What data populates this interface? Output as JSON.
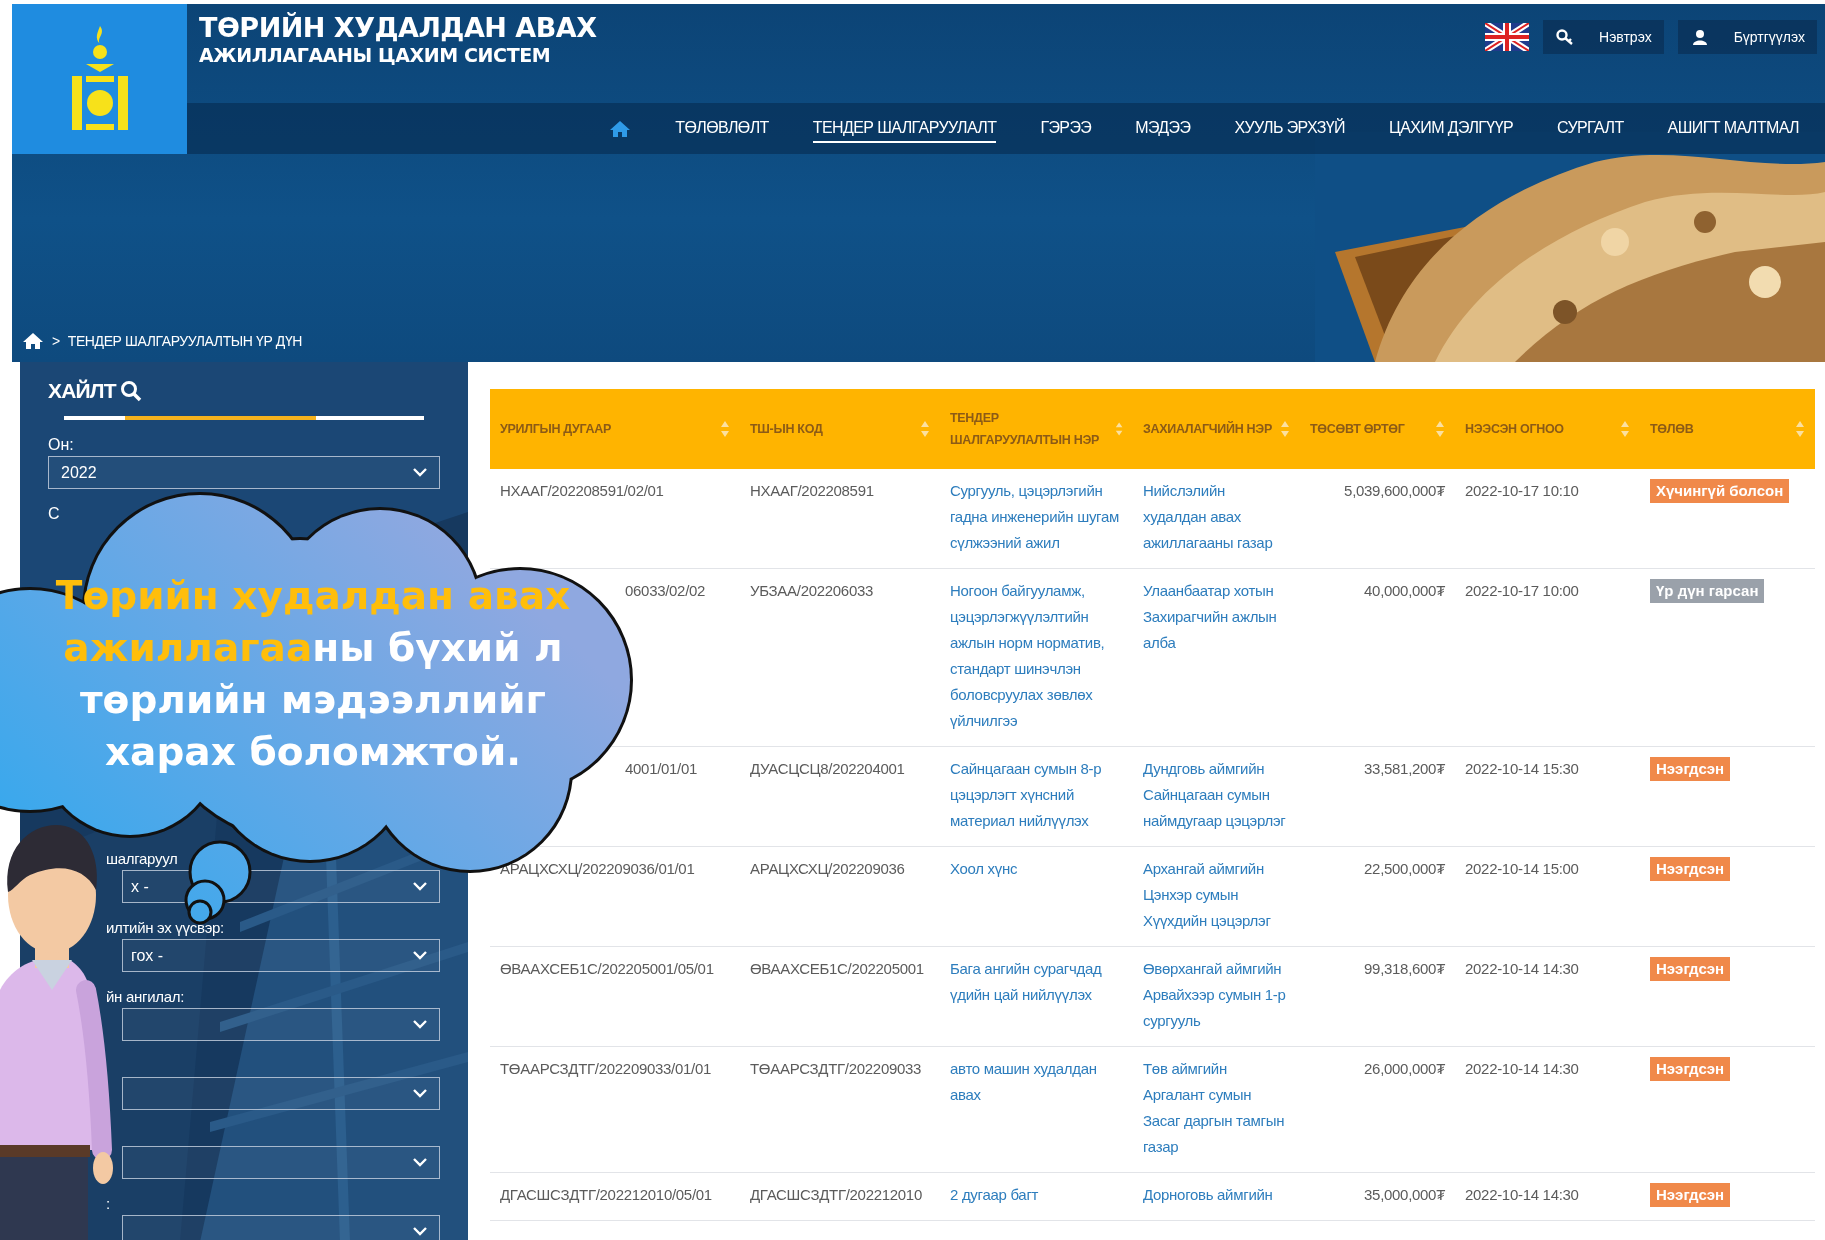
{
  "header": {
    "title_line_1": "ТӨРИЙН ХУДАЛДАН АВАХ",
    "title_line_2": "АЖИЛЛАГААНЫ ЦАХИМ СИСТЕМ",
    "login": "Нэвтрэх",
    "register": "Бүртгүүлэх"
  },
  "nav": [
    {
      "label": "ТӨЛӨВЛӨЛТ",
      "selected": false
    },
    {
      "label": "ТЕНДЕР ШАЛГАРУУЛАЛТ",
      "selected": true
    },
    {
      "label": "ГЭРЭЭ",
      "selected": false
    },
    {
      "label": "МЭДЭЭ",
      "selected": false
    },
    {
      "label": "ХУУЛЬ ЭРХЗҮЙ",
      "selected": false
    },
    {
      "label": "ЦАХИМ ДЭЛГҮҮР",
      "selected": false
    },
    {
      "label": "СУРГАЛТ",
      "selected": false
    },
    {
      "label": "АШИГТ МАЛТМАЛ",
      "selected": false
    }
  ],
  "breadcrumb": {
    "separator": ">",
    "current": "ТЕНДЕР ШАЛГАРУУЛАЛТЫН ҮР ДҮН"
  },
  "sidebar": {
    "title": "ХАЙЛТ",
    "fields": [
      {
        "kind": "select",
        "label": "Он:",
        "value": "2022"
      },
      {
        "kind": "covered",
        "label": "С"
      },
      {
        "kind": "covered"
      },
      {
        "kind": "covered"
      },
      {
        "kind": "covered"
      },
      {
        "kind": "covered"
      },
      {
        "kind": "select-cut",
        "label": "шалгаруул",
        "value": "х -"
      },
      {
        "kind": "select-cut",
        "label": "илтийн эх үүсвэр:",
        "value": "гох -"
      },
      {
        "kind": "select-cut",
        "label": "йн ангилал:"
      },
      {
        "kind": "select-cut"
      },
      {
        "kind": "select-cut"
      },
      {
        "kind": "select-cut",
        "label": ":"
      }
    ]
  },
  "table": {
    "columns": [
      "УРИЛГЫН ДУГААР",
      "ТШ-ЫН КОД",
      "ТЕНДЕР ШАЛГАРУУЛАЛТЫН НЭР",
      "ЗАХИАЛАГЧИЙН НЭР",
      "ТӨСӨВТ ӨРТӨГ",
      "НЭЭСЭН ОГНОО",
      "ТӨЛӨВ"
    ],
    "rows": [
      {
        "covered": false,
        "invitation": "НХААГ/202208591/02/01",
        "code": "НХААГ/202208591",
        "tender": "Сургууль, цэцэрлэгийн гадна инженерийн шугам сүлжээний ажил",
        "customer": "Нийслэлийн худалдан авах ажиллагааны газар",
        "budget": "5,039,600,000₮",
        "opened": "2022-10-17 10:10",
        "status": "Хүчингүй болсон",
        "color": "#f0894a"
      },
      {
        "covered": true,
        "invitation": "06033/02/02",
        "code": "УБЗАА/202206033",
        "tender": "Ногоон байгууламж, цэцэрлэгжүүлэлтийн ажлын норм норматив, стандарт шинэчлэн боловсруулах зөвлөх үйлчилгээ",
        "customer": "Улаанбаатар хотын Захирагчийн ажлын алба",
        "budget": "40,000,000₮",
        "opened": "2022-10-17 10:00",
        "status": "Үр дүн гарсан",
        "color": "#9aa1aa"
      },
      {
        "covered": true,
        "invitation": "4001/01/01",
        "code": "ДУАСЦСЦ8/202204001",
        "tender": "Сайнцагаан сумын 8-р цэцэрлэгт хүнсний материал нийлүүлэх",
        "customer": "Дундговь аймгийн Сайнцагаан сумын наймдугаар цэцэрлэг",
        "budget": "33,581,200₮",
        "opened": "2022-10-14 15:30",
        "status": "Нээгдсэн",
        "color": "#f0894a"
      },
      {
        "covered": false,
        "invitation": "АРАЦХСХЦ/202209036/01/01",
        "code": "АРАЦХСХЦ/202209036",
        "tender": "Хоол хүнс",
        "customer": "Архангай аймгийн Цэнхэр сумын Хүүхдийн цэцэрлэг",
        "budget": "22,500,000₮",
        "opened": "2022-10-14 15:00",
        "status": "Нээгдсэн",
        "color": "#f0894a"
      },
      {
        "covered": false,
        "invitation": "ӨВААХСЕБ1С/202205001/05/01",
        "code": "ӨВААХСЕБ1С/202205001",
        "tender": "Бага ангийн сурагчдад үдийн цай нийлүүлэх",
        "customer": "Өвөрхангай аймгийн Арвайхээр сумын 1-р сургууль",
        "budget": "99,318,600₮",
        "opened": "2022-10-14 14:30",
        "status": "Нээгдсэн",
        "color": "#f0894a"
      },
      {
        "covered": false,
        "invitation": "ТӨААРСЗДТГ/202209033/01/01",
        "code": "ТӨААРСЗДТГ/202209033",
        "tender": "авто машин худалдан авах",
        "customer": "Төв аймгийн Аргалант сумын Засаг даргын тамгын газар",
        "budget": "26,000,000₮",
        "opened": "2022-10-14 14:30",
        "status": "Нээгдсэн",
        "color": "#f0894a"
      },
      {
        "covered": false,
        "invitation": "ДГАСШСЗДТГ/202212010/05/01",
        "code": "ДГАСШСЗДТГ/202212010",
        "tender": "2 дугаар багт",
        "customer": "Дорноговь аймгийн",
        "budget": "35,000,000₮",
        "opened": "2022-10-14 14:30",
        "status": "Нээгдсэн",
        "color": "#f0894a"
      }
    ]
  },
  "callout": {
    "text": "**Төрийн худалдан авах ажиллагаа**ны бүхий л төрлийн мэдээллийг харах боломжтой."
  }
}
